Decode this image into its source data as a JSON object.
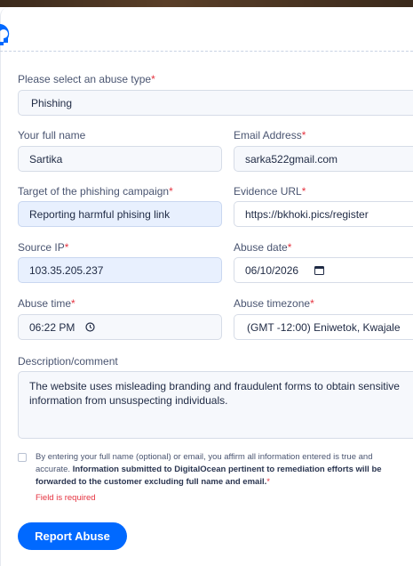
{
  "form": {
    "abuse_type": {
      "label": "Please select an abuse type",
      "value": "Phishing"
    },
    "full_name": {
      "label": "Your full name",
      "value": "Sartika"
    },
    "email": {
      "label": "Email Address",
      "value": "sarka522gmail.com"
    },
    "target": {
      "label": "Target of the phishing campaign",
      "value": "Reporting harmful phising link"
    },
    "evidence_url": {
      "label": "Evidence URL",
      "value": "https://bkhoki.pics/register"
    },
    "source_ip": {
      "label": "Source IP",
      "value": "103.35.205.237"
    },
    "abuse_date": {
      "label": "Abuse date",
      "value": "06/10/2026"
    },
    "abuse_time": {
      "label": "Abuse time",
      "value": "06:22 PM"
    },
    "abuse_timezone": {
      "label": "Abuse timezone",
      "value": "(GMT -12:00) Eniwetok, Kwajale"
    },
    "description": {
      "label": "Description/comment",
      "value": "The website uses misleading branding and fraudulent forms to obtain sensitive information from unsuspecting individuals."
    },
    "required_marker": "*",
    "consent_text": "By entering your full name (optional) or email, you affirm all information entered is true and accurate.",
    "consent_bold": "Information submitted to DigitalOcean pertinent to remediation efforts will be forwarded to the customer excluding full name and email.",
    "error_text": "Field is required",
    "submit_label": "Report Abuse"
  },
  "colors": {
    "accent": "#0069ff",
    "required": "#e5323f",
    "autofill": "#e8f0fe"
  },
  "icons": [
    "digitalocean-logo",
    "calendar-icon",
    "clock-icon"
  ]
}
